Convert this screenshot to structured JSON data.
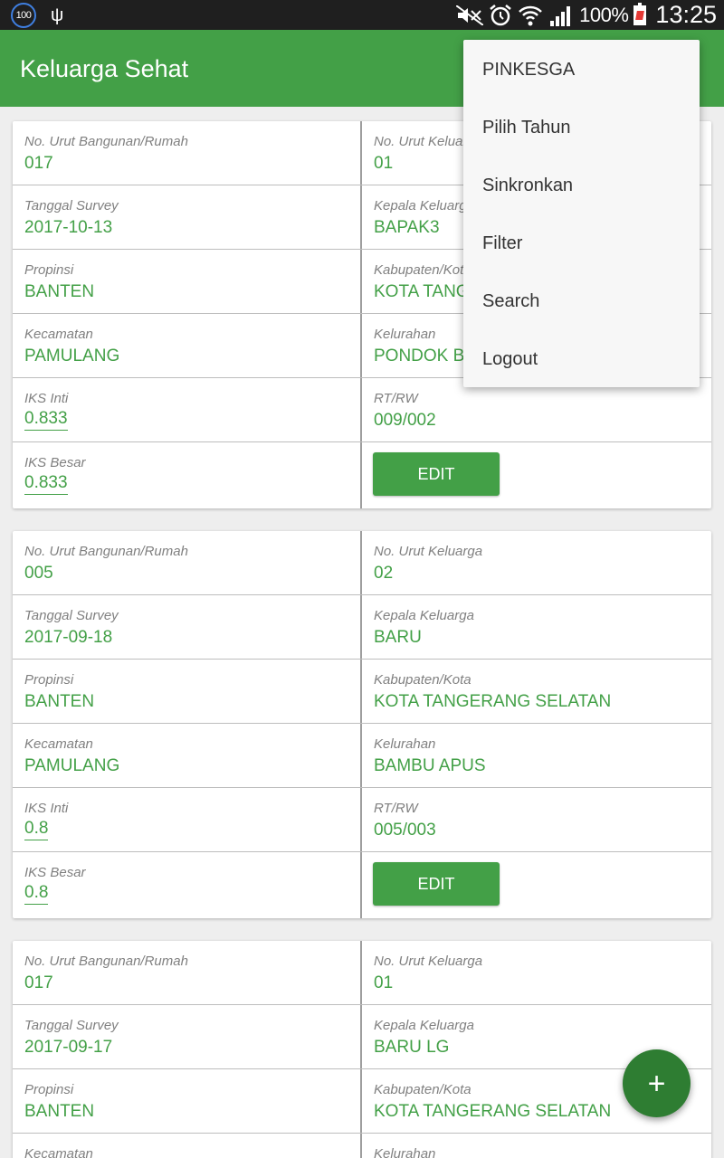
{
  "status_bar": {
    "notification_count": "100",
    "battery_percent": "100%",
    "time": "13:25"
  },
  "app_bar": {
    "title": "Keluarga Sehat"
  },
  "menu": {
    "items": [
      "PINKESGA",
      "Pilih Tahun",
      "Sinkronkan",
      "Filter",
      "Search",
      "Logout"
    ]
  },
  "labels": {
    "no_bangunan": "No. Urut Bangunan/Rumah",
    "no_keluarga": "No. Urut Keluarga",
    "tanggal": "Tanggal Survey",
    "kepala": "Kepala Keluarga",
    "propinsi": "Propinsi",
    "kabupaten": "Kabupaten/Kota",
    "kecamatan": "Kecamatan",
    "kelurahan": "Kelurahan",
    "iks_inti": "IKS Inti",
    "rtrw": "RT/RW",
    "iks_besar": "IKS Besar",
    "edit": "EDIT"
  },
  "cards": [
    {
      "no_bangunan": "017",
      "no_keluarga": "01",
      "tanggal": "2017-10-13",
      "kepala": "BAPAK3",
      "propinsi": "BANTEN",
      "kabupaten": "KOTA TANG",
      "kecamatan": "PAMULANG",
      "kelurahan": "PONDOK BE",
      "iks_inti": "0.833",
      "rtrw": "009/002",
      "iks_besar": "0.833"
    },
    {
      "no_bangunan": "005",
      "no_keluarga": "02",
      "tanggal": "2017-09-18",
      "kepala": "BARU",
      "propinsi": "BANTEN",
      "kabupaten": "KOTA TANGERANG SELATAN",
      "kecamatan": "PAMULANG",
      "kelurahan": "BAMBU APUS",
      "iks_inti": "0.8",
      "rtrw": "005/003",
      "iks_besar": "0.8"
    },
    {
      "no_bangunan": "017",
      "no_keluarga": "01",
      "tanggal": "2017-09-17",
      "kepala": "BARU LG",
      "propinsi": "BANTEN",
      "kabupaten": "KOTA TANGERANG SELATAN",
      "kecamatan": "",
      "kelurahan": ""
    }
  ],
  "fab": {
    "icon": "plus-icon",
    "label": "+"
  }
}
